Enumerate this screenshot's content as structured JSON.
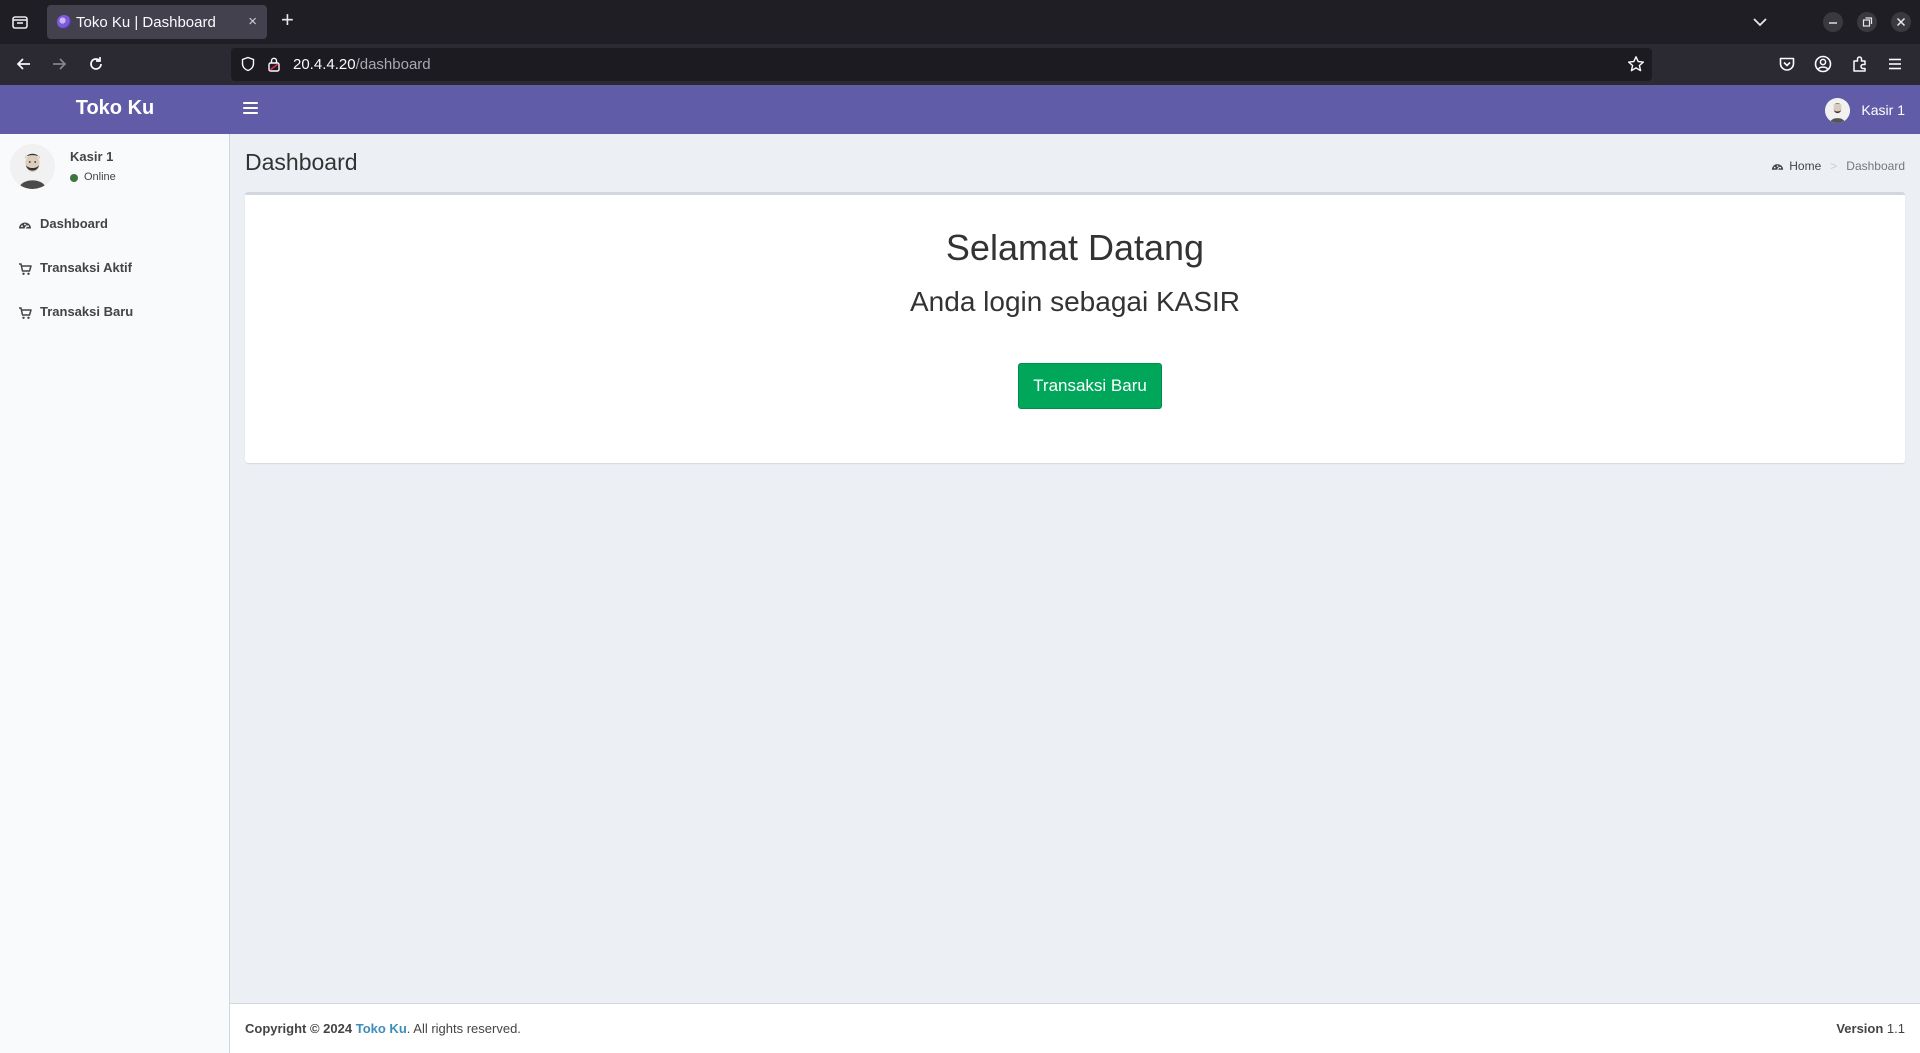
{
  "browser": {
    "tab_title": "Toko Ku | Dashboard",
    "new_tab_symbol": "+",
    "close_tab_symbol": "×",
    "url_host": "20.4.4.20",
    "url_path": "/dashboard",
    "window_controls": [
      "minimize",
      "restore",
      "close"
    ]
  },
  "header": {
    "logo": "Toko Ku",
    "user_name": "Kasir 1"
  },
  "sidebar": {
    "user_name": "Kasir 1",
    "status": "Online",
    "status_color": "#3c763d",
    "items": [
      {
        "label": "Dashboard",
        "icon": "dashboard-icon"
      },
      {
        "label": "Transaksi Aktif",
        "icon": "cart-icon"
      },
      {
        "label": "Transaksi Baru",
        "icon": "cart-icon"
      }
    ]
  },
  "content": {
    "page_title": "Dashboard",
    "breadcrumb": {
      "home": "Home",
      "current": "Dashboard"
    },
    "welcome": "Selamat Datang",
    "login_as": "Anda login sebagai KASIR",
    "button_label": "Transaksi Baru"
  },
  "footer": {
    "copyright": "Copyright © 2024",
    "brand": "Toko Ku",
    "rights": ". All rights reserved.",
    "version_label": "Version",
    "version": "1.1"
  },
  "colors": {
    "header_bg": "#605ca8",
    "button_bg": "#00a65a",
    "link": "#3c8dbc"
  }
}
